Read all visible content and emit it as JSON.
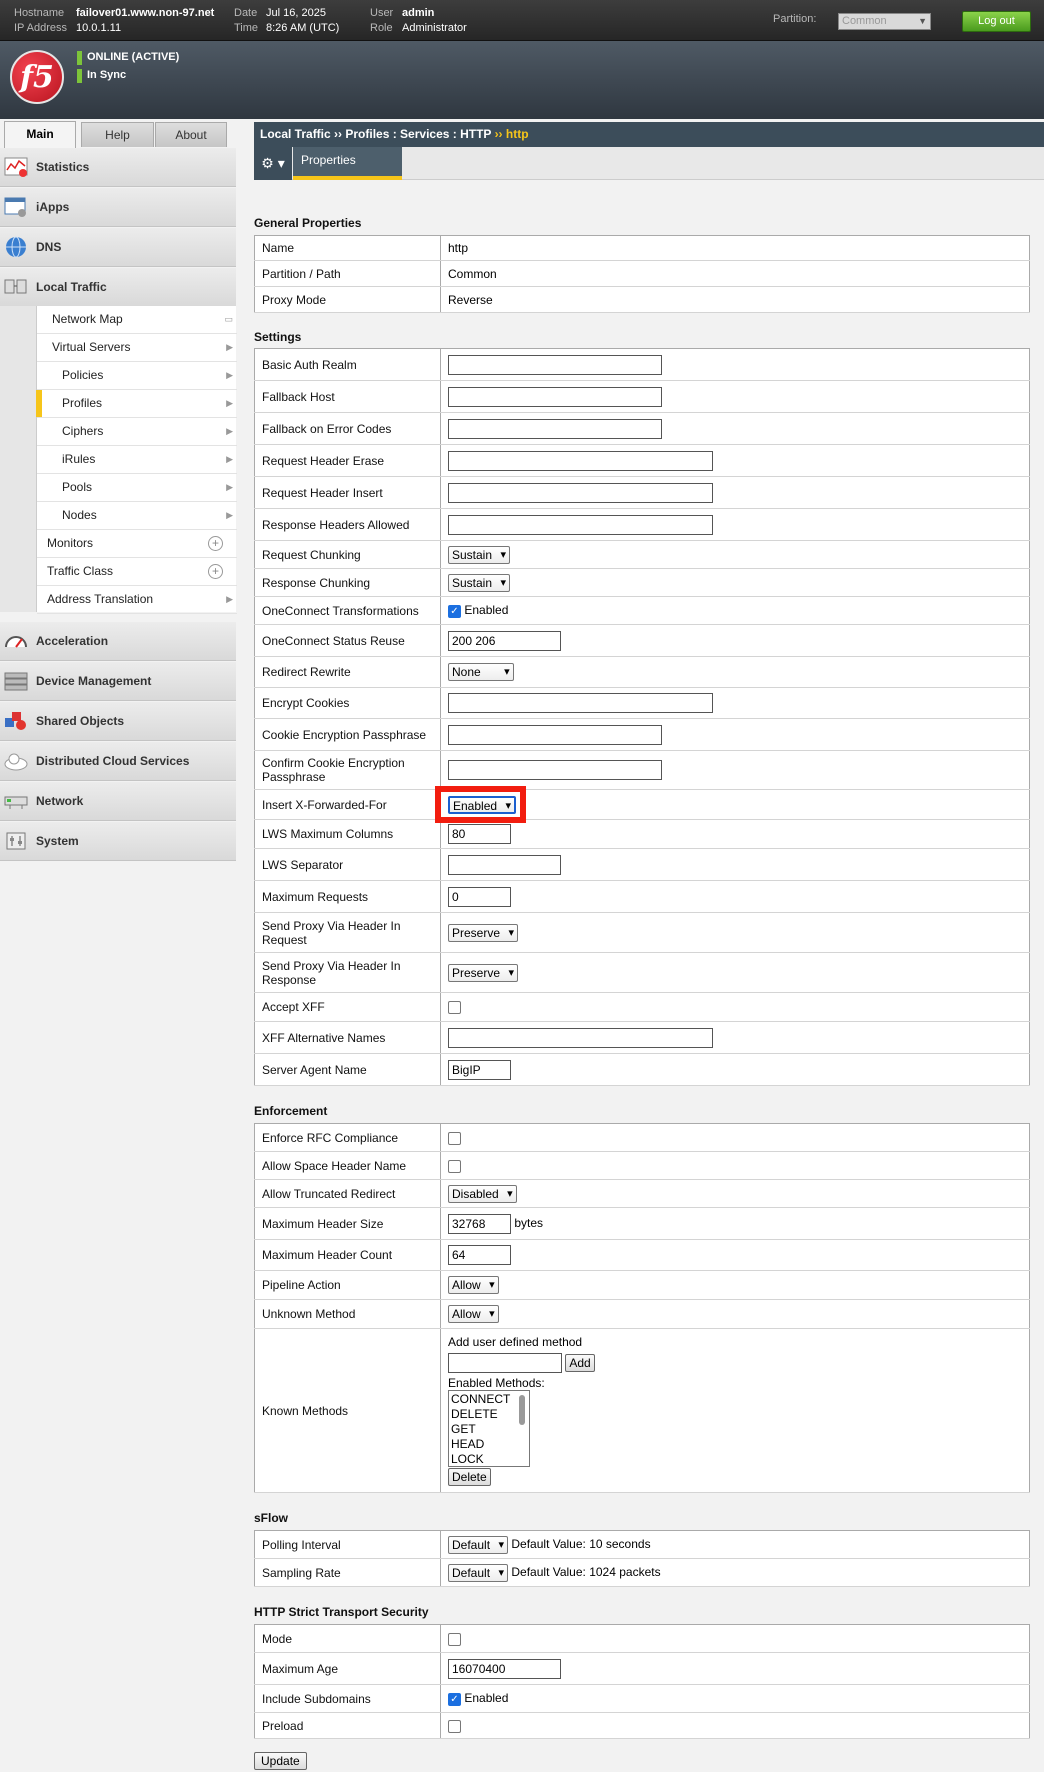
{
  "header": {
    "hostname_label": "Hostname",
    "hostname": "failover01.www.non-97.net",
    "ip_label": "IP Address",
    "ip": "10.0.1.11",
    "date_label": "Date",
    "date": "Jul 16, 2025",
    "time_label": "Time",
    "time": "8:26 AM (UTC)",
    "user_label": "User",
    "user": "admin",
    "role_label": "Role",
    "role": "Administrator",
    "partition_label": "Partition:",
    "partition_value": "Common",
    "logout_label": "Log out",
    "status_online": "ONLINE (ACTIVE)",
    "status_sync": "In Sync",
    "logo_text": "f5"
  },
  "nav": {
    "tabs": [
      "Main",
      "Help",
      "About"
    ],
    "sections": {
      "statistics": "Statistics",
      "iapps": "iApps",
      "dns": "DNS",
      "local_traffic": "Local Traffic",
      "acceleration": "Acceleration",
      "device_management": "Device Management",
      "shared_objects": "Shared Objects",
      "distributed_cloud": "Distributed Cloud Services",
      "network": "Network",
      "system": "System"
    },
    "local_traffic_items": [
      "Network Map",
      "Virtual Servers",
      "Policies",
      "Profiles",
      "Ciphers",
      "iRules",
      "Pools",
      "Nodes",
      "Monitors",
      "Traffic Class",
      "Address Translation"
    ]
  },
  "breadcrumb": {
    "part1": "Local Traffic",
    "sep1": "››",
    "part2": "Profiles : Services : HTTP",
    "sep2": "››",
    "current": "http"
  },
  "tabs": {
    "gear": "⚙ ▾",
    "properties": "Properties"
  },
  "general": {
    "title": "General Properties",
    "name_label": "Name",
    "name": "http",
    "partition_label": "Partition / Path",
    "partition": "Common",
    "proxy_label": "Proxy Mode",
    "proxy": "Reverse"
  },
  "settings": {
    "title": "Settings",
    "basic_auth_realm": "Basic Auth Realm",
    "fallback_host": "Fallback Host",
    "fallback_error_codes": "Fallback on Error Codes",
    "req_header_erase": "Request Header Erase",
    "req_header_insert": "Request Header Insert",
    "resp_headers_allowed": "Response Headers Allowed",
    "req_chunking_label": "Request Chunking",
    "req_chunking": "Sustain",
    "resp_chunking_label": "Response Chunking",
    "resp_chunking": "Sustain",
    "oneconnect_transform_label": "OneConnect Transformations",
    "oneconnect_transform": "Enabled",
    "oneconnect_status_label": "OneConnect Status Reuse",
    "oneconnect_status": "200 206",
    "redirect_rewrite_label": "Redirect Rewrite",
    "redirect_rewrite": "None",
    "encrypt_cookies": "Encrypt Cookies",
    "cookie_passphrase": "Cookie Encryption Passphrase",
    "confirm_cookie_passphrase": "Confirm Cookie Encryption Passphrase",
    "insert_xff_label": "Insert X-Forwarded-For",
    "insert_xff": "Enabled",
    "lws_max_columns_label": "LWS Maximum Columns",
    "lws_max_columns": "80",
    "lws_separator": "LWS Separator",
    "max_requests_label": "Maximum Requests",
    "max_requests": "0",
    "proxy_via_req_label": "Send Proxy Via Header In Request",
    "proxy_via_req": "Preserve",
    "proxy_via_resp_label": "Send Proxy Via Header In Response",
    "proxy_via_resp": "Preserve",
    "accept_xff": "Accept XFF",
    "xff_alt_names": "XFF Alternative Names",
    "server_agent_label": "Server Agent Name",
    "server_agent": "BigIP"
  },
  "enforcement": {
    "title": "Enforcement",
    "rfc_compliance": "Enforce RFC Compliance",
    "allow_space_header": "Allow Space Header Name",
    "truncated_redirect_label": "Allow Truncated Redirect",
    "truncated_redirect": "Disabled",
    "max_header_size_label": "Maximum Header Size",
    "max_header_size": "32768",
    "max_header_size_unit": "bytes",
    "max_header_count_label": "Maximum Header Count",
    "max_header_count": "64",
    "pipeline_action_label": "Pipeline Action",
    "pipeline_action": "Allow",
    "unknown_method_label": "Unknown Method",
    "unknown_method": "Allow",
    "known_methods_label": "Known Methods",
    "add_method_label": "Add user defined method",
    "add_button": "Add",
    "enabled_methods_label": "Enabled Methods:",
    "methods": [
      "CONNECT",
      "DELETE",
      "GET",
      "HEAD",
      "LOCK"
    ],
    "delete_button": "Delete"
  },
  "sflow": {
    "title": "sFlow",
    "polling_label": "Polling Interval",
    "polling": "Default",
    "polling_default": "Default Value: 10 seconds",
    "sampling_label": "Sampling Rate",
    "sampling": "Default",
    "sampling_default": "Default Value: 1024 packets"
  },
  "hsts": {
    "title": "HTTP Strict Transport Security",
    "mode": "Mode",
    "max_age_label": "Maximum Age",
    "max_age": "16070400",
    "include_subdomains_label": "Include Subdomains",
    "include_subdomains": "Enabled",
    "preload": "Preload"
  },
  "update_button": "Update"
}
